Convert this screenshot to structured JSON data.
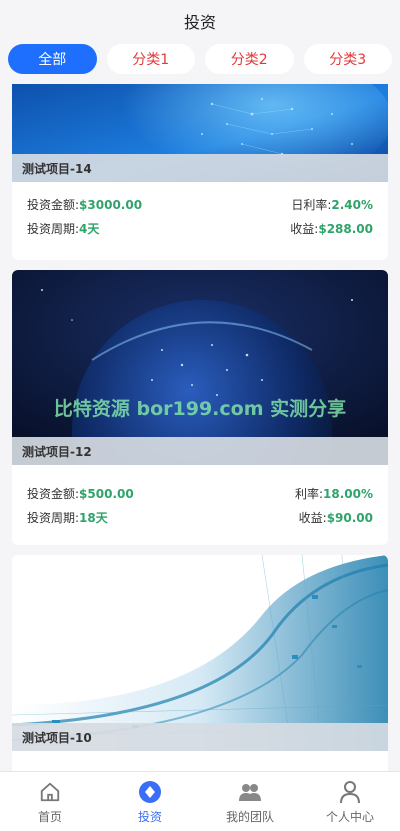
{
  "header": {
    "title": "投资"
  },
  "tabs": [
    {
      "label": "全部",
      "active": true
    },
    {
      "label": "分类1",
      "active": false
    },
    {
      "label": "分类2",
      "active": false
    },
    {
      "label": "分类3",
      "active": false
    }
  ],
  "projects": [
    {
      "title": "测试项目-14",
      "amount_label": "投资金额:",
      "amount": "$3000.00",
      "rate_label": "日利率:",
      "rate": "2.40%",
      "period_label": "投资周期:",
      "period": "4天",
      "income_label": "收益:",
      "income": "$288.00"
    },
    {
      "title": "测试项目-12",
      "watermark": "比特资源 bor199.com 实测分享",
      "amount_label": "投资金额:",
      "amount": "$500.00",
      "rate_label": "利率:",
      "rate": "18.00%",
      "period_label": "投资周期:",
      "period": "18天",
      "income_label": "收益:",
      "income": "$90.00"
    },
    {
      "title": "测试项目-10"
    }
  ],
  "nav": [
    {
      "label": "首页",
      "icon": "home-icon",
      "active": false
    },
    {
      "label": "投资",
      "icon": "invest-icon",
      "active": true
    },
    {
      "label": "我的团队",
      "icon": "team-icon",
      "active": false
    },
    {
      "label": "个人中心",
      "icon": "user-icon",
      "active": false
    }
  ],
  "colors": {
    "accent": "#1f6fff",
    "value_green": "#2fa36b",
    "tab_text": "#e03a3a"
  }
}
